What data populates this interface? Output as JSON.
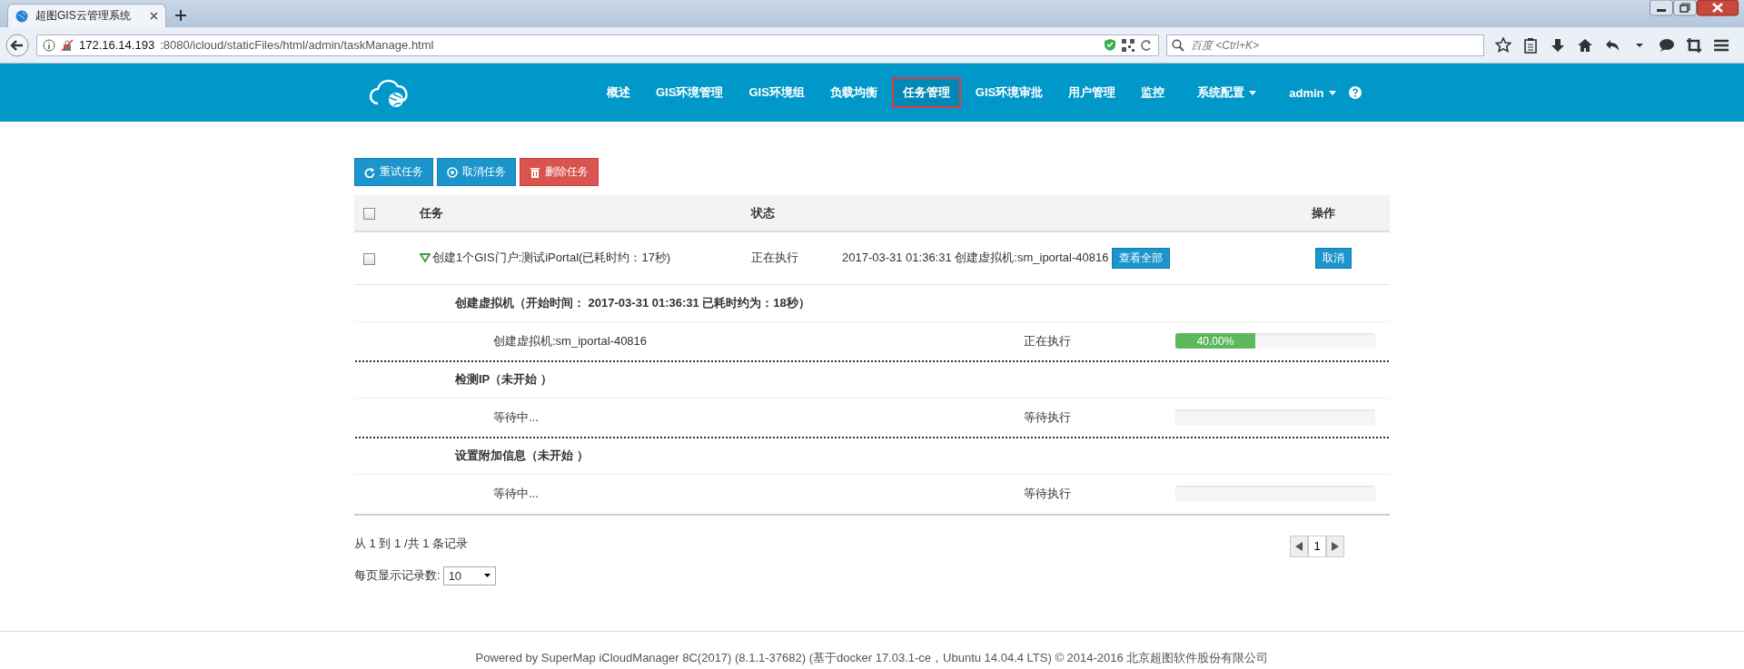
{
  "browser": {
    "tab_title": "超图GIS云管理系统",
    "url_host": "172.16.14.193",
    "url_path": ":8080/icloud/staticFiles/html/admin/taskManage.html",
    "search_placeholder": "百度 <Ctrl+K>"
  },
  "nav": {
    "items": [
      {
        "label": "概述",
        "selected": false,
        "dropdown": false
      },
      {
        "label": "GIS环境管理",
        "selected": false,
        "dropdown": false
      },
      {
        "label": "GIS环境组",
        "selected": false,
        "dropdown": false
      },
      {
        "label": "负载均衡",
        "selected": false,
        "dropdown": false
      },
      {
        "label": "任务管理",
        "selected": true,
        "dropdown": false
      },
      {
        "label": "GIS环境审批",
        "selected": false,
        "dropdown": false
      },
      {
        "label": "用户管理",
        "selected": false,
        "dropdown": false
      },
      {
        "label": "监控",
        "selected": false,
        "dropdown": false
      },
      {
        "label": "系统配置",
        "selected": false,
        "dropdown": true
      },
      {
        "label": "admin",
        "selected": false,
        "dropdown": true
      }
    ]
  },
  "toolbar": [
    {
      "label": "重试任务",
      "kind": "retry"
    },
    {
      "label": "取消任务",
      "kind": "cancel"
    },
    {
      "label": "删除任务",
      "kind": "delete"
    }
  ],
  "table": {
    "select_all": false,
    "columns": [
      "任务",
      "状态",
      "操作"
    ],
    "rows": [
      {
        "checked": false,
        "expanded": true,
        "task": "创建1个GIS门户:测试iPortal(已耗时约：17秒)",
        "status": "正在执行",
        "detail": "2017-03-31 01:36:31 创建虚拟机:sm_iportal-40816",
        "detail_button": "查看全部",
        "action": "取消",
        "subtasks": [
          {
            "title": "创建虚拟机（开始时间： 2017-03-31 01:36:31 已耗时约为：18秒）",
            "items": [
              {
                "name": "创建虚拟机:sm_iportal-40816",
                "status": "正在执行",
                "level": 0.4,
                "reading": "40.00%"
              }
            ]
          },
          {
            "title": "检测IP（未开始 ）",
            "items": [
              {
                "name": "等待中...",
                "status": "等待执行",
                "level": 0
              }
            ]
          },
          {
            "title": "设置附加信息（未开始 ）",
            "items": [
              {
                "name": "等待中...",
                "status": "等待执行",
                "level": 0
              }
            ]
          }
        ]
      }
    ]
  },
  "pagination": {
    "summary": "从 1 到 1 /共 1 条记录",
    "pages": [
      {
        "label": "1",
        "selected": true
      }
    ],
    "page_size_label": "每页显示记录数:",
    "page_size": "10"
  },
  "footer": "Powered by SuperMap iCloudManager 8C(2017) (8.1.1-37682) (基于docker 17.03.1-ce，Ubuntu 14.04.4 LTS) © 2014-2016 北京超图软件股份有限公司"
}
